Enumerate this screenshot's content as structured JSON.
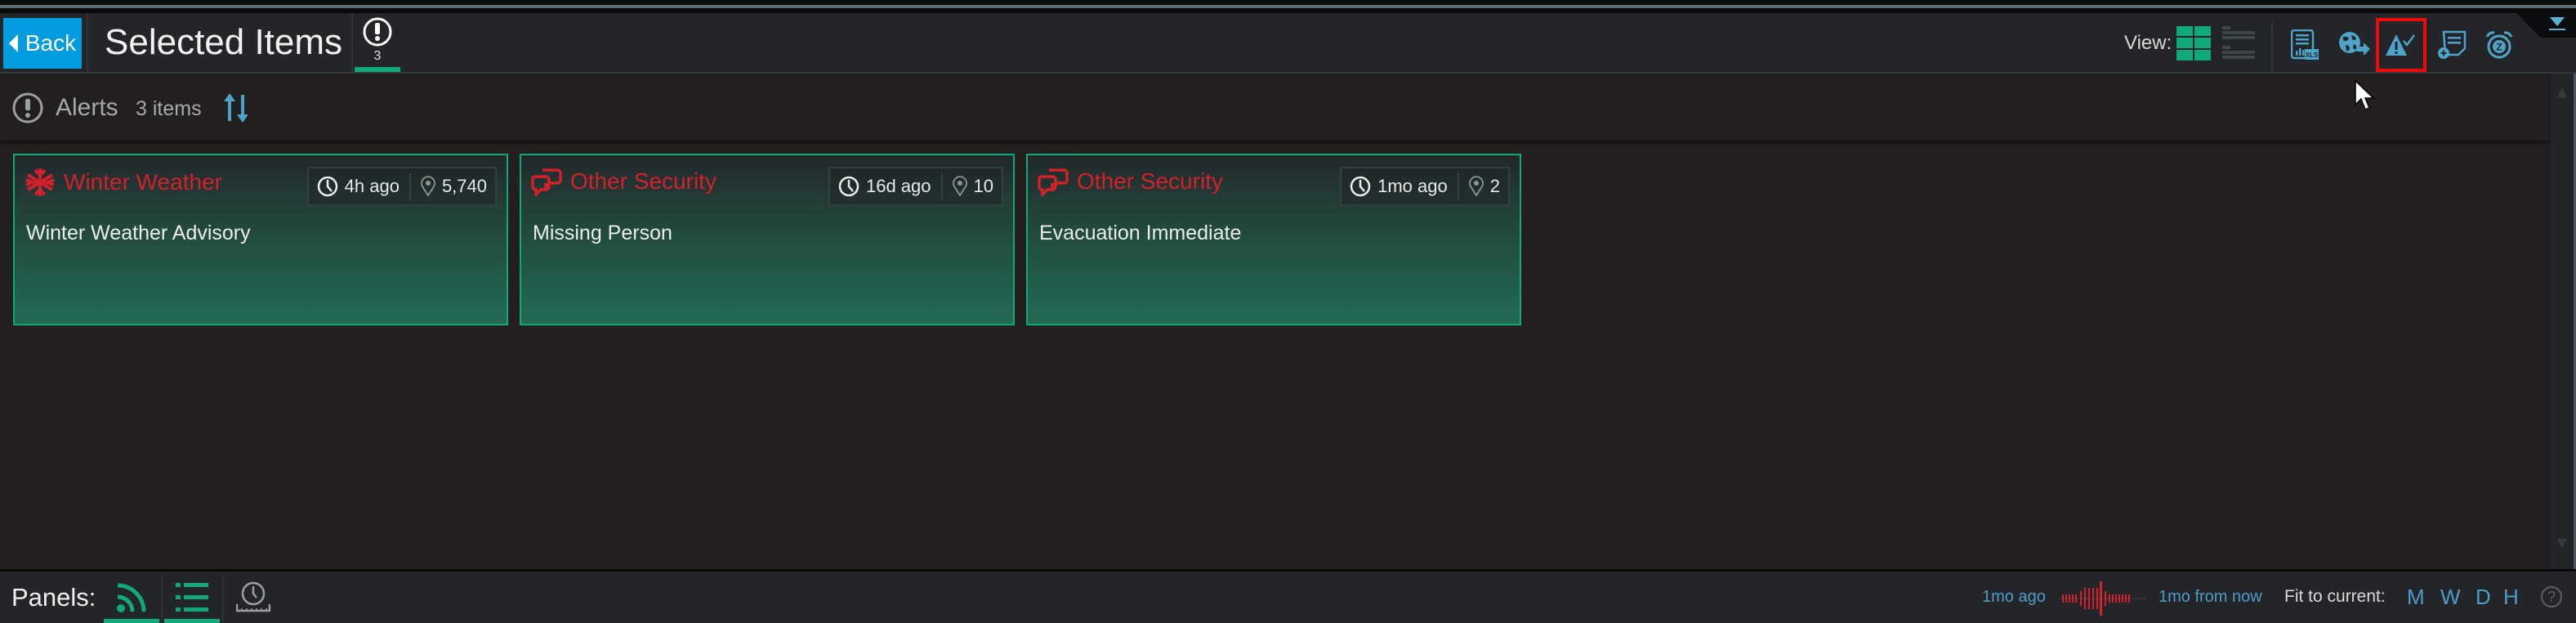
{
  "header": {
    "back_label": "Back",
    "title": "Selected Items",
    "alert_tab_count": "3",
    "view_label": "View:"
  },
  "toolbar": {
    "icons": [
      {
        "name": "export-xls-icon",
        "label": "XLS"
      },
      {
        "name": "globe-share-icon"
      },
      {
        "name": "acknowledge-alert-icon",
        "selected": true
      },
      {
        "name": "add-note-icon"
      },
      {
        "name": "snooze-alarm-icon",
        "label": "Z"
      }
    ]
  },
  "subheader": {
    "title": "Alerts",
    "count": "3 items"
  },
  "cards": [
    {
      "category": "Winter Weather",
      "icon": "snowflake-icon",
      "time": "4h ago",
      "locations": "5,740",
      "description": "Winter Weather Advisory"
    },
    {
      "category": "Other Security",
      "icon": "security-chat-icon",
      "time": "16d ago",
      "locations": "10",
      "description": "Missing Person"
    },
    {
      "category": "Other Security",
      "icon": "security-chat-icon",
      "time": "1mo ago",
      "locations": "2",
      "description": "Evacuation Immediate"
    }
  ],
  "footer": {
    "panels_label": "Panels:",
    "timeline_from": "1mo ago",
    "timeline_to": "1mo from now",
    "fit_label": "Fit to current:",
    "fit_options": [
      "M",
      "W",
      "D",
      "H"
    ],
    "help": "?"
  },
  "colors": {
    "accent_green": "#12a97a",
    "alert_red": "#d3202b",
    "link_blue": "#4d9cc8",
    "back_blue": "#049ce0",
    "selection_red": "#ee0a0a"
  }
}
